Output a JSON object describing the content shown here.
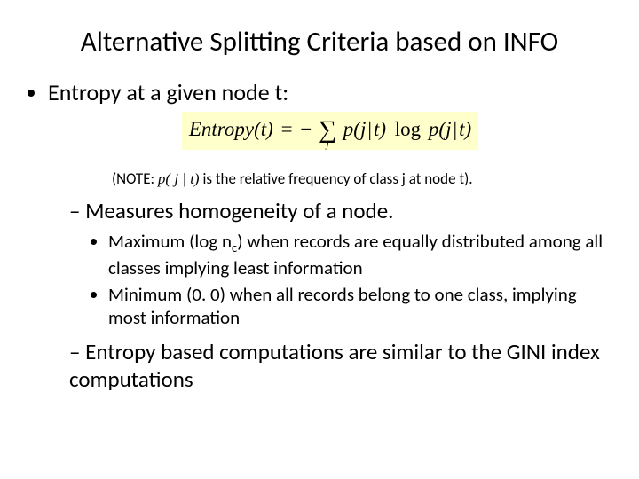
{
  "title": "Alternative Splitting Criteria based on INFO",
  "bullets": {
    "entropy": "Entropy at a given node t:"
  },
  "equation": {
    "lhs": "Entropy(t)",
    "eq": "=",
    "minus": "−",
    "sum_sub": "j",
    "p1a": "p(",
    "p1b": "j",
    "p1c": "t)",
    "log": "log",
    "p2a": "p(",
    "p2b": "j",
    "p2c": "t)"
  },
  "note": {
    "prefix": "(NOTE: ",
    "p_expr": "p( j | t)",
    "suffix": " is the relative frequency of class j at node t)."
  },
  "sub": {
    "measures": "Measures homogeneity of a node.",
    "max_a": "Maximum (log n",
    "max_sub": "c",
    "max_b": ") when records are equally distributed among all classes implying least information",
    "min": "Minimum (0. 0) when all records belong to one class, implying most information",
    "entropy_gini": "Entropy based computations are similar to the GINI index computations"
  }
}
